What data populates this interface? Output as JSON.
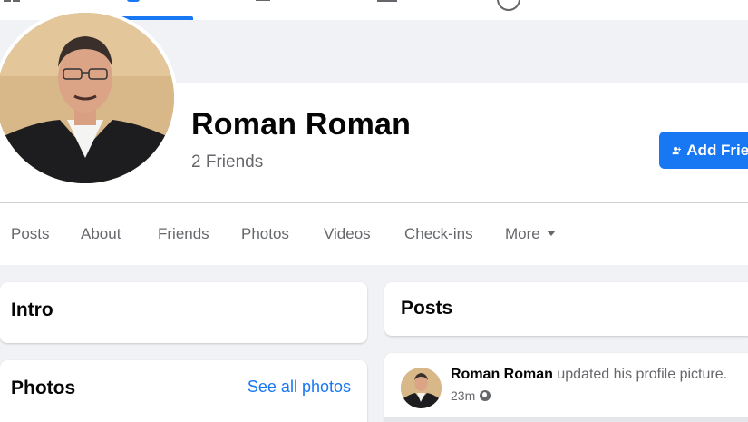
{
  "profile": {
    "name": "Roman Roman",
    "friends": "2 Friends",
    "add_friend_label": "Add Friend"
  },
  "tabs": [
    "Posts",
    "About",
    "Friends",
    "Photos",
    "Videos",
    "Check-ins",
    "More"
  ],
  "intro": {
    "title": "Intro"
  },
  "photos": {
    "title": "Photos",
    "see_all": "See all photos"
  },
  "posts": {
    "title": "Posts",
    "item": {
      "author": "Roman Roman",
      "action": "updated his profile picture.",
      "time": "23m"
    }
  },
  "colors": {
    "accent": "#1877f2",
    "page_bg": "#f0f2f5",
    "secondary_text": "#65676b"
  },
  "icons": [
    "home-icon",
    "profile-icon",
    "watch-icon",
    "marketplace-icon",
    "groups-icon",
    "add-friend-icon",
    "globe-icon",
    "caret-down-icon"
  ]
}
